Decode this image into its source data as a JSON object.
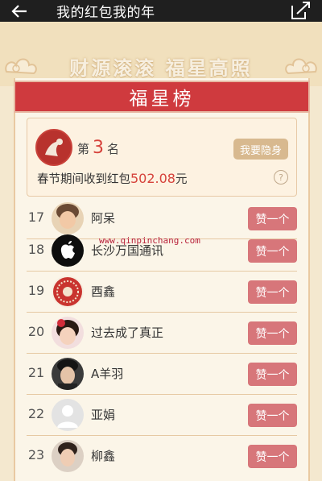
{
  "header": {
    "title": "我的红包我的年"
  },
  "banner": {
    "slogan": "财源滚滚 福星高照"
  },
  "leaderboard": {
    "title": "福星榜"
  },
  "my_rank": {
    "prefix": "第",
    "number": "3",
    "suffix": "名",
    "hide_button": "我要隐身",
    "summary_text": "春节期间收到红包",
    "amount": "502.08",
    "unit": "元",
    "help_symbol": "?"
  },
  "like_label": "赞一个",
  "list": [
    {
      "rank": "17",
      "name": "阿呆"
    },
    {
      "rank": "18",
      "name": "长沙万国通讯"
    },
    {
      "rank": "19",
      "name": "酉鑫"
    },
    {
      "rank": "20",
      "name": "过去成了真正"
    },
    {
      "rank": "21",
      "name": "A羊羽"
    },
    {
      "rank": "22",
      "name": "亚娟"
    },
    {
      "rank": "23",
      "name": "柳鑫"
    }
  ],
  "watermark": "www.qinpinchang.com",
  "colors": {
    "app_bar": "#1f1f1f",
    "ribbon": "#cf3a3e",
    "highlight": "#d6423b",
    "like_button": "#d7767a",
    "background": "#f4e8cf"
  }
}
